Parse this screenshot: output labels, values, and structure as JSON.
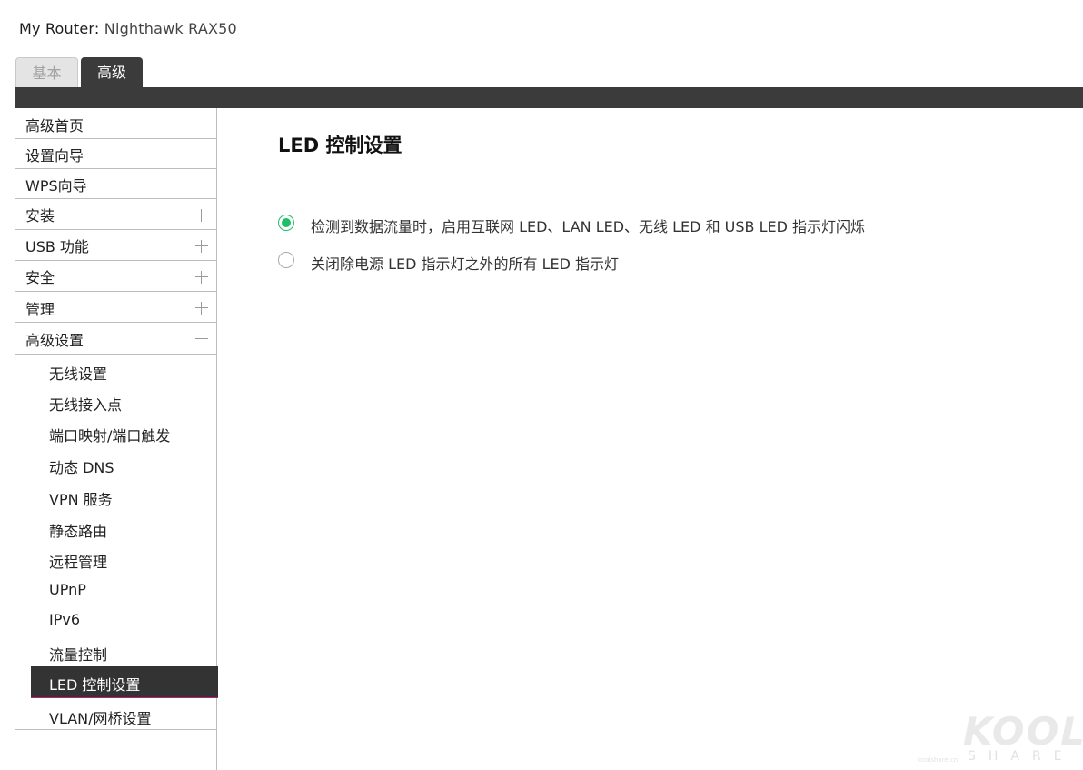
{
  "header": {
    "router_label": "My Router:",
    "router_model": "Nighthawk RAX50"
  },
  "tabs": [
    {
      "label": "基本",
      "active": false
    },
    {
      "label": "高级",
      "active": true
    }
  ],
  "sidebar": {
    "items": [
      {
        "label": "高级首页",
        "toggle": ""
      },
      {
        "label": "设置向导",
        "toggle": ""
      },
      {
        "label": "WPS向导",
        "toggle": ""
      },
      {
        "label": "安装",
        "toggle": "plus"
      },
      {
        "label": "USB 功能",
        "toggle": "plus"
      },
      {
        "label": "安全",
        "toggle": "plus"
      },
      {
        "label": "管理",
        "toggle": "plus"
      },
      {
        "label": "高级设置",
        "toggle": "minus"
      }
    ],
    "sub_items": [
      {
        "label": "无线设置"
      },
      {
        "label": "无线接入点"
      },
      {
        "label": "端口映射/端口触发"
      },
      {
        "label": "动态 DNS"
      },
      {
        "label": "VPN 服务"
      },
      {
        "label": "静态路由"
      },
      {
        "label": "远程管理"
      },
      {
        "label": "UPnP"
      },
      {
        "label": "IPv6"
      },
      {
        "label": "流量控制"
      },
      {
        "label": "LED 控制设置",
        "active": true
      },
      {
        "label": "VLAN/网桥设置"
      }
    ]
  },
  "main": {
    "title": "LED 控制设置",
    "options": [
      {
        "label": "检测到数据流量时，启用互联网 LED、LAN LED、无线 LED 和 USB LED 指示灯闪烁",
        "checked": true
      },
      {
        "label": "关闭除电源 LED 指示灯之外的所有 LED 指示灯",
        "checked": false
      }
    ]
  },
  "watermark": {
    "main": "KOOL",
    "sub": "SHARE",
    "small": "koolshare.cn"
  },
  "colors": {
    "accent_green": "#1fbf6a",
    "dark_bar": "#3b3b3b",
    "active_underline": "#c2187a"
  }
}
